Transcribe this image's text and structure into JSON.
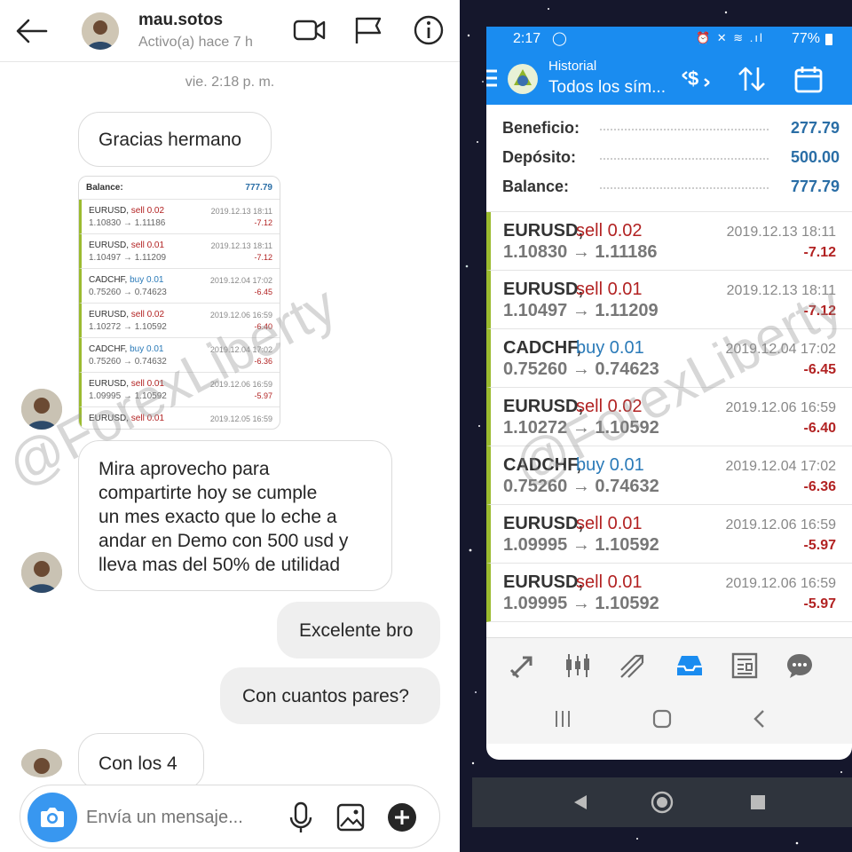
{
  "chat": {
    "header": {
      "username": "mau.sotos",
      "status": "Activo(a) hace 7 h"
    },
    "timestamp": "vie. 2:18 p. m.",
    "messages": [
      {
        "text": "Gracias hermano"
      },
      {
        "text_lines": [
          "Mira aprovecho para",
          "compartirte hoy se cumple",
          "un mes exacto que lo eche a",
          "andar en Demo con 500 usd y",
          "lleva mas del 50% de utilidad"
        ]
      },
      {
        "text": "Excelente bro"
      },
      {
        "text": "Con cuantos pares?"
      },
      {
        "text": "Con los 4"
      }
    ],
    "thumbnail": {
      "balance_label": "Balance:",
      "balance_value": "777.79",
      "rows": [
        {
          "symbol": "EURUSD,",
          "side": "sell 0.02",
          "prices": "1.10830 → 1.11186",
          "date": "2019.12.13 18:11",
          "pl": "-7.12"
        },
        {
          "symbol": "EURUSD,",
          "side": "sell 0.01",
          "prices": "1.10497 → 1.11209",
          "date": "2019.12.13 18:11",
          "pl": "-7.12"
        },
        {
          "symbol": "CADCHF,",
          "side": "buy 0.01",
          "prices": "0.75260 → 0.74623",
          "date": "2019.12.04 17:02",
          "pl": "-6.45"
        },
        {
          "symbol": "EURUSD,",
          "side": "sell 0.02",
          "prices": "1.10272 → 1.10592",
          "date": "2019.12.06 16:59",
          "pl": "-6.40"
        },
        {
          "symbol": "CADCHF,",
          "side": "buy 0.01",
          "prices": "0.75260 → 0.74632",
          "date": "2019.12.04 17:02",
          "pl": "-6.36"
        },
        {
          "symbol": "EURUSD,",
          "side": "sell 0.01",
          "prices": "1.09995 → 1.10592",
          "date": "2019.12.06 16:59",
          "pl": "-5.97"
        },
        {
          "symbol": "EURUSD,",
          "side": "sell 0.01",
          "prices": "",
          "date": "2019.12.05 16:59",
          "pl": ""
        }
      ]
    },
    "composer": {
      "placeholder": "Envía un mensaje..."
    }
  },
  "phone": {
    "status_time": "2:17",
    "battery": "77%",
    "appbar": {
      "subtitle": "Historial",
      "title": "Todos los sím..."
    },
    "summary": [
      {
        "label": "Beneficio:",
        "value": "277.79"
      },
      {
        "label": "Depósito:",
        "value": "500.00"
      },
      {
        "label": "Balance:",
        "value": "777.79"
      }
    ],
    "trades": [
      {
        "symbol": "EURUSD,",
        "side": "sell 0.02",
        "side_type": "sell",
        "prices": "1.10830 → 1.11186",
        "date": "2019.12.13 18:11",
        "pl": "-7.12"
      },
      {
        "symbol": "EURUSD,",
        "side": "sell 0.01",
        "side_type": "sell",
        "prices": "1.10497 → 1.11209",
        "date": "2019.12.13 18:11",
        "pl": "-7.12"
      },
      {
        "symbol": "CADCHF,",
        "side": "buy 0.01",
        "side_type": "buy",
        "prices": "0.75260 → 0.74623",
        "date": "2019.12.04 17:02",
        "pl": "-6.45"
      },
      {
        "symbol": "EURUSD,",
        "side": "sell 0.02",
        "side_type": "sell",
        "prices": "1.10272 → 1.10592",
        "date": "2019.12.06 16:59",
        "pl": "-6.40"
      },
      {
        "symbol": "CADCHF,",
        "side": "buy 0.01",
        "side_type": "buy",
        "prices": "0.75260 → 0.74632",
        "date": "2019.12.04 17:02",
        "pl": "-6.36"
      },
      {
        "symbol": "EURUSD,",
        "side": "sell 0.01",
        "side_type": "sell",
        "prices": "1.09995 → 1.10592",
        "date": "2019.12.06 16:59",
        "pl": "-5.97"
      },
      {
        "symbol": "EURUSD,",
        "side": "sell 0.01",
        "side_type": "sell",
        "prices": "1.09995 → 1.10592",
        "date": "2019.12.06 16:59",
        "pl": "-5.97"
      }
    ],
    "colors": {
      "accent": "#1a8cf0",
      "sell": "#b22222",
      "buy": "#2a7ab8",
      "loss": "#b22222",
      "profit": "#2a6ea6",
      "row_bar": "#9bbb2f"
    }
  },
  "watermark": "@ForexLiberty",
  "icons": {
    "chat_header": [
      "back-arrow-icon",
      "video-call-icon",
      "flag-icon",
      "info-icon"
    ],
    "composer": [
      "camera-icon",
      "microphone-icon",
      "gallery-icon",
      "add-icon"
    ],
    "phone_toolbar": [
      "quotes-icon",
      "chart-icon",
      "trade-icon",
      "history-icon",
      "news-icon",
      "messages-icon"
    ],
    "nav": [
      "recents-icon",
      "home-icon",
      "back-icon"
    ]
  }
}
